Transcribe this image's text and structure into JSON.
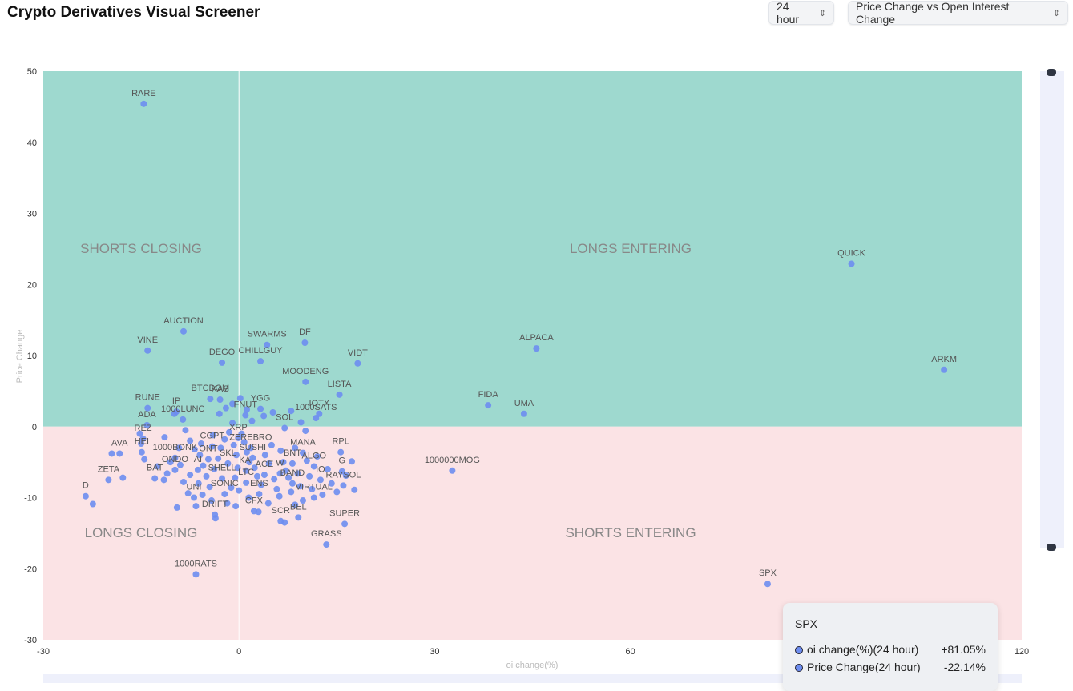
{
  "header": {
    "title": "Crypto Derivatives Visual Screener",
    "timeframe": "24 hour",
    "view": "Price Change vs Open Interest Change"
  },
  "chart_data": {
    "type": "scatter",
    "xlabel": "oi change(%)",
    "ylabel": "Price Change",
    "xlim": [
      -30,
      120
    ],
    "ylim": [
      -30,
      50
    ],
    "xticks": [
      -30,
      0,
      30,
      60,
      120
    ],
    "yticks": [
      50,
      40,
      30,
      20,
      10,
      0,
      -10,
      -20,
      -30
    ],
    "grid": false,
    "colors": {
      "positive_region": "#9ed9cf",
      "negative_region": "#fbe3e5",
      "point": "#6d8df0"
    },
    "quadrants": {
      "top_left": "SHORTS CLOSING",
      "top_right": "LONGS ENTERING",
      "bottom_left": "LONGS CLOSING",
      "bottom_right": "SHORTS ENTERING"
    },
    "labeled_points": [
      {
        "name": "RARE",
        "x": -14.6,
        "y": 45.4
      },
      {
        "name": "QUICK",
        "x": 93.9,
        "y": 22.9
      },
      {
        "name": "AUCTION",
        "x": -8.5,
        "y": 13.4
      },
      {
        "name": "VINE",
        "x": -14.0,
        "y": 10.7
      },
      {
        "name": "SWARMS",
        "x": 4.3,
        "y": 11.5
      },
      {
        "name": "DF",
        "x": 10.1,
        "y": 11.8
      },
      {
        "name": "DEGO",
        "x": -2.6,
        "y": 9.0
      },
      {
        "name": "CHILLGUY",
        "x": 3.3,
        "y": 9.2
      },
      {
        "name": "VIDT",
        "x": 18.2,
        "y": 8.9
      },
      {
        "name": "ALPACA",
        "x": 45.6,
        "y": 11.0
      },
      {
        "name": "ARKM",
        "x": 108.1,
        "y": 8.0
      },
      {
        "name": "MOODENG",
        "x": 10.2,
        "y": 6.3
      },
      {
        "name": "LISTA",
        "x": 15.4,
        "y": 4.5
      },
      {
        "name": "BTCDOM",
        "x": -4.4,
        "y": 3.9
      },
      {
        "name": "RUNE",
        "x": -14.0,
        "y": 2.6
      },
      {
        "name": "IP",
        "x": -9.6,
        "y": 2.1
      },
      {
        "name": "KAS",
        "x": -2.9,
        "y": 3.8
      },
      {
        "name": "YGG",
        "x": 3.3,
        "y": 2.5
      },
      {
        "name": "IOTX",
        "x": 12.3,
        "y": 1.8
      },
      {
        "name": "FIDA",
        "x": 38.2,
        "y": 3.0
      },
      {
        "name": "UMA",
        "x": 43.7,
        "y": 1.8
      },
      {
        "name": "ADA",
        "x": -14.1,
        "y": 0.2
      },
      {
        "name": "1000LUNC",
        "x": -8.6,
        "y": 1.0
      },
      {
        "name": "FNUT",
        "x": 1.0,
        "y": 1.6
      },
      {
        "name": "1000SATS",
        "x": 11.8,
        "y": 1.2
      },
      {
        "name": "SOL",
        "x": 7.0,
        "y": -0.2
      },
      {
        "name": "REZ",
        "x": -14.7,
        "y": -1.7
      },
      {
        "name": "XRP",
        "x": -0.1,
        "y": -1.6
      },
      {
        "name": "AVA",
        "x": -18.3,
        "y": -3.8
      },
      {
        "name": "HEI",
        "x": -14.9,
        "y": -3.6
      },
      {
        "name": "1000BONK",
        "x": -9.8,
        "y": -4.4
      },
      {
        "name": "CGPT",
        "x": -4.1,
        "y": -2.8
      },
      {
        "name": "ONT",
        "x": -4.7,
        "y": -4.6
      },
      {
        "name": "ZEREBRO",
        "x": 1.8,
        "y": -3.0
      },
      {
        "name": "SUSHI",
        "x": 2.1,
        "y": -4.4
      },
      {
        "name": "MANA",
        "x": 9.8,
        "y": -3.7
      },
      {
        "name": "RPL",
        "x": 15.6,
        "y": -3.6
      },
      {
        "name": "SKL",
        "x": -1.7,
        "y": -5.2
      },
      {
        "name": "BNT",
        "x": 8.2,
        "y": -5.2
      },
      {
        "name": "ALGO",
        "x": 11.5,
        "y": -5.6
      },
      {
        "name": "ONDO",
        "x": -9.8,
        "y": -6.1
      },
      {
        "name": "AI",
        "x": -6.3,
        "y": -6.1
      },
      {
        "name": "KAI",
        "x": 1.1,
        "y": -6.2
      },
      {
        "name": "ACE",
        "x": 3.9,
        "y": -6.8
      },
      {
        "name": "W",
        "x": 6.3,
        "y": -6.6
      },
      {
        "name": "G",
        "x": 15.8,
        "y": -6.3
      },
      {
        "name": "ZETA",
        "x": -20.0,
        "y": -7.5
      },
      {
        "name": "BAT",
        "x": -12.9,
        "y": -7.3
      },
      {
        "name": "SHELL",
        "x": -2.6,
        "y": -7.3
      },
      {
        "name": "LTC",
        "x": 1.1,
        "y": -7.9
      },
      {
        "name": "BAND",
        "x": 8.2,
        "y": -8.0
      },
      {
        "name": "IO",
        "x": 12.5,
        "y": -7.5
      },
      {
        "name": "RAYSOL",
        "x": 16.0,
        "y": -8.3
      },
      {
        "name": "1000000MOG",
        "x": 32.7,
        "y": -6.2
      },
      {
        "name": "D",
        "x": -23.5,
        "y": -9.8
      },
      {
        "name": "UNI",
        "x": -6.9,
        "y": -10.0
      },
      {
        "name": "SONIC",
        "x": -2.2,
        "y": -9.5
      },
      {
        "name": "ENS",
        "x": 3.1,
        "y": -9.5
      },
      {
        "name": "VIRTUAL",
        "x": 11.5,
        "y": -10.0
      },
      {
        "name": "DRIFT",
        "x": -3.7,
        "y": -12.4
      },
      {
        "name": "CFX",
        "x": 2.3,
        "y": -11.9
      },
      {
        "name": "SCR",
        "x": 6.4,
        "y": -13.3
      },
      {
        "name": "BEL",
        "x": 9.1,
        "y": -12.8
      },
      {
        "name": "SUPER",
        "x": 16.2,
        "y": -13.7
      },
      {
        "name": "GRASS",
        "x": 13.4,
        "y": -16.6
      },
      {
        "name": "1000RATS",
        "x": -6.6,
        "y": -20.8
      },
      {
        "name": "SPX",
        "x": 81.05,
        "y": -22.14
      }
    ],
    "other_points": [
      [
        -22.4,
        -10.9
      ],
      [
        -19.5,
        -3.8
      ],
      [
        -17.8,
        -7.2
      ],
      [
        -11.5,
        -7.5
      ],
      [
        -9.5,
        -11.4
      ],
      [
        -11.4,
        -1.5
      ],
      [
        -9.9,
        1.8
      ],
      [
        -8.2,
        -0.5
      ],
      [
        -7.5,
        -2.0
      ],
      [
        -6.8,
        -3.2
      ],
      [
        -6.0,
        -4.0
      ],
      [
        -5.5,
        -5.5
      ],
      [
        -5.0,
        -7.0
      ],
      [
        -4.5,
        -8.5
      ],
      [
        -7.5,
        -6.8
      ],
      [
        -8.5,
        -7.8
      ],
      [
        -6.2,
        -8.0
      ],
      [
        -3.8,
        -6.0
      ],
      [
        -3.2,
        -4.5
      ],
      [
        -2.8,
        -3.0
      ],
      [
        -2.2,
        -1.8
      ],
      [
        -1.5,
        -0.8
      ],
      [
        -1.0,
        0.5
      ],
      [
        -0.8,
        -2.6
      ],
      [
        -0.4,
        -4.0
      ],
      [
        -0.2,
        -5.8
      ],
      [
        -0.6,
        -7.2
      ],
      [
        -1.2,
        -8.6
      ],
      [
        -1.8,
        -10.8
      ],
      [
        -3.6,
        -12.9
      ],
      [
        -4.2,
        -10.4
      ],
      [
        -5.6,
        -9.6
      ],
      [
        -6.6,
        -11.2
      ],
      [
        -7.8,
        -9.4
      ],
      [
        0.4,
        -1.0
      ],
      [
        0.8,
        -2.2
      ],
      [
        1.2,
        -3.6
      ],
      [
        1.6,
        -5.0
      ],
      [
        2.4,
        -5.8
      ],
      [
        2.8,
        -7.0
      ],
      [
        3.4,
        -8.2
      ],
      [
        4.0,
        -4.0
      ],
      [
        4.6,
        -5.2
      ],
      [
        5.0,
        -2.6
      ],
      [
        5.4,
        -7.4
      ],
      [
        5.8,
        -8.8
      ],
      [
        6.4,
        -3.4
      ],
      [
        6.8,
        -5.0
      ],
      [
        7.2,
        -6.2
      ],
      [
        7.6,
        -7.2
      ],
      [
        8.0,
        -9.2
      ],
      [
        8.6,
        -3.0
      ],
      [
        9.0,
        -6.6
      ],
      [
        9.4,
        -8.4
      ],
      [
        9.8,
        -10.4
      ],
      [
        10.4,
        -4.8
      ],
      [
        10.8,
        -7.0
      ],
      [
        11.2,
        -8.8
      ],
      [
        12.0,
        -4.2
      ],
      [
        12.8,
        -9.6
      ],
      [
        13.6,
        -6.0
      ],
      [
        14.2,
        -8.0
      ],
      [
        15.0,
        -9.2
      ],
      [
        17.3,
        -4.9
      ],
      [
        17.7,
        -8.9
      ],
      [
        16.4,
        -6.9
      ],
      [
        3.0,
        -12.0
      ],
      [
        4.5,
        -10.8
      ],
      [
        7.0,
        -13.5
      ],
      [
        8.6,
        -11.0
      ],
      [
        1.5,
        -10.0
      ],
      [
        -0.5,
        -11.2
      ],
      [
        2.0,
        0.8
      ],
      [
        3.8,
        1.5
      ],
      [
        5.2,
        2.0
      ],
      [
        8.0,
        2.2
      ],
      [
        9.5,
        0.6
      ],
      [
        10.2,
        -0.6
      ],
      [
        -3.0,
        1.8
      ],
      [
        -2.0,
        2.6
      ],
      [
        -1.0,
        3.2
      ],
      [
        0.2,
        4.0
      ],
      [
        1.2,
        2.4
      ],
      [
        -4.0,
        -1.2
      ],
      [
        -5.8,
        -2.4
      ],
      [
        -9.2,
        -3.0
      ],
      [
        -10.5,
        -5.0
      ],
      [
        -12.5,
        -5.6
      ],
      [
        -15.0,
        -2.4
      ],
      [
        -15.2,
        -1.0
      ],
      [
        -14.5,
        -4.6
      ],
      [
        -11.0,
        -6.6
      ],
      [
        -9.0,
        -5.4
      ],
      [
        0.0,
        -9.0
      ],
      [
        6.2,
        -9.8
      ]
    ]
  },
  "tooltip": {
    "name": "SPX",
    "rows": [
      {
        "label": "oi change(%)(24 hour)",
        "value": "+81.05%"
      },
      {
        "label": "Price Change(24 hour)",
        "value": "-22.14%"
      }
    ]
  }
}
